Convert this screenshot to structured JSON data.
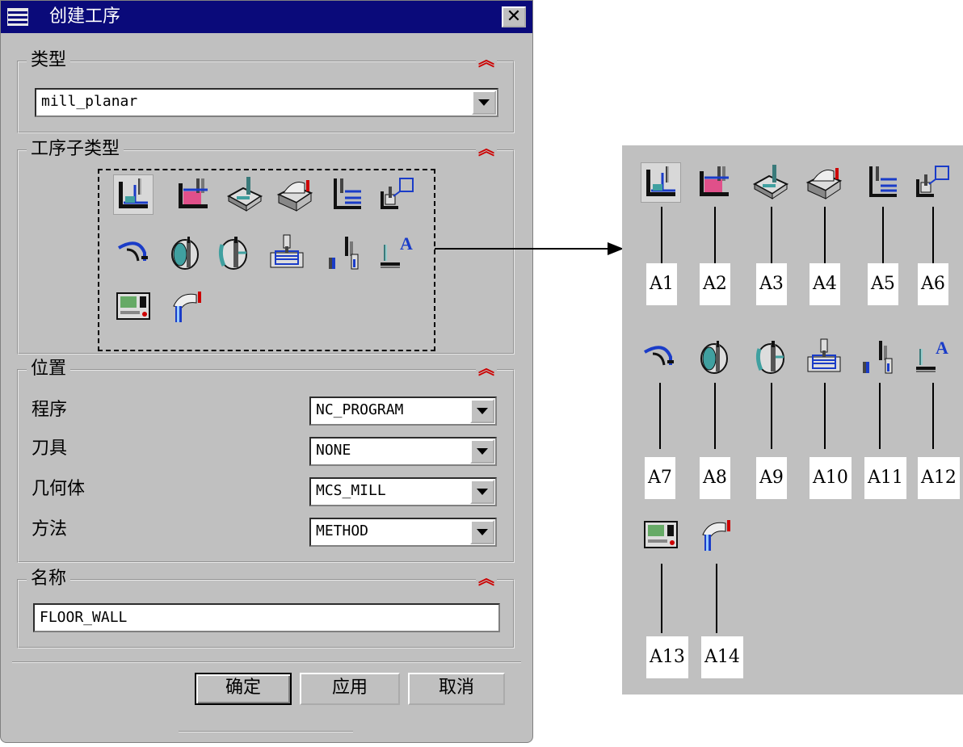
{
  "window": {
    "title": "创建工序",
    "close_label": "✕"
  },
  "type_group": {
    "title": "类型",
    "collapse_icon": "⌃⌃",
    "value": "mill_planar"
  },
  "subtype_group": {
    "title": "工序子类型",
    "collapse_icon": "⌃⌃",
    "icons": [
      "A1",
      "A2",
      "A3",
      "A4",
      "A5",
      "A6",
      "A7",
      "A8",
      "A9",
      "A10",
      "A11",
      "A12",
      "A13",
      "A14"
    ],
    "selected": "A1"
  },
  "location_group": {
    "title": "位置",
    "collapse_icon": "⌃⌃",
    "rows": [
      {
        "label": "程序",
        "value": "NC_PROGRAM"
      },
      {
        "label": "刀具",
        "value": "NONE"
      },
      {
        "label": "几何体",
        "value": "MCS_MILL"
      },
      {
        "label": "方法",
        "value": "METHOD"
      }
    ]
  },
  "name_group": {
    "title": "名称",
    "collapse_icon": "⌃⌃",
    "value": "FLOOR_WALL"
  },
  "buttons": {
    "ok": "确定",
    "apply": "应用",
    "cancel": "取消"
  },
  "annotation_labels": [
    "A1",
    "A2",
    "A3",
    "A4",
    "A5",
    "A6",
    "A7",
    "A8",
    "A9",
    "A10",
    "A11",
    "A12",
    "A13",
    "A14"
  ],
  "colors": {
    "titlebar": "#0a0a7a",
    "dialog_bg": "#c0c0c0",
    "collapse_icon": "#cc0000",
    "icon_blue": "#1a3cc8",
    "icon_teal": "#40a0a0",
    "icon_pink": "#e0508a"
  }
}
